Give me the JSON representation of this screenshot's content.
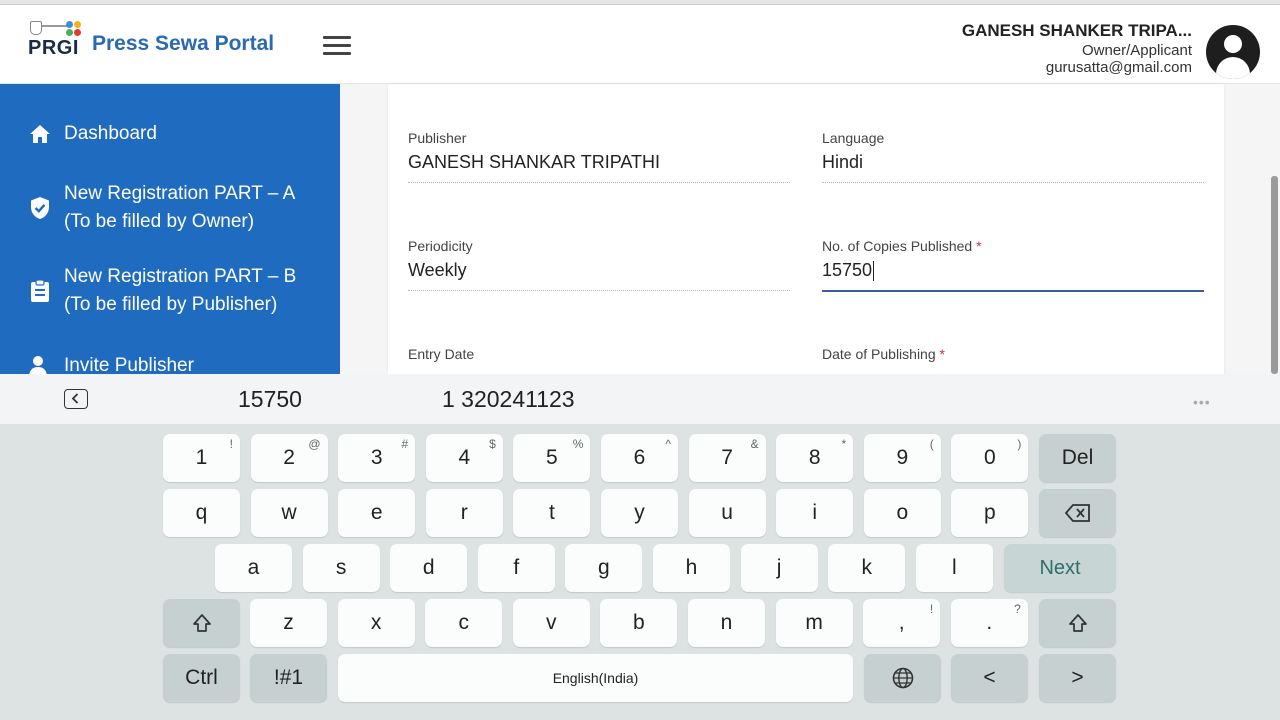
{
  "header": {
    "logo_text": "PRGI",
    "brand": "Press Sewa Portal",
    "user_name": "GANESH SHANKER TRIPA...",
    "user_role": "Owner/Applicant",
    "user_email": "gurusatta@gmail.com"
  },
  "sidebar": {
    "items": [
      {
        "label": "Dashboard",
        "icon": "home-icon"
      },
      {
        "label": "New Registration PART – A",
        "label2": "(To be filled by Owner)",
        "icon": "shield-check-icon"
      },
      {
        "label": "New Registration PART – B",
        "label2": "(To be filled by Publisher)",
        "icon": "clipboard-icon"
      },
      {
        "label": "Invite Publisher",
        "icon": "user-plus-icon"
      }
    ]
  },
  "form": {
    "publisher_label": "Publisher",
    "publisher_value": "GANESH SHANKAR TRIPATHI",
    "language_label": "Language",
    "language_value": "Hindi",
    "periodicity_label": "Periodicity",
    "periodicity_value": "Weekly",
    "copies_label": "No. of Copies Published",
    "copies_value": "15750",
    "entry_date_label": "Entry Date",
    "publishing_date_label": "Date of Publishing",
    "required_mark": "*"
  },
  "keyboard": {
    "suggestions": [
      "15750",
      "1 320241123"
    ],
    "row1": [
      {
        "k": "1",
        "s": "!"
      },
      {
        "k": "2",
        "s": "@"
      },
      {
        "k": "3",
        "s": "#"
      },
      {
        "k": "4",
        "s": "$"
      },
      {
        "k": "5",
        "s": "%"
      },
      {
        "k": "6",
        "s": "^"
      },
      {
        "k": "7",
        "s": "&"
      },
      {
        "k": "8",
        "s": "*"
      },
      {
        "k": "9",
        "s": "("
      },
      {
        "k": "0",
        "s": ")"
      }
    ],
    "del": "Del",
    "row2": [
      "q",
      "w",
      "e",
      "r",
      "t",
      "y",
      "u",
      "i",
      "o",
      "p"
    ],
    "row3": [
      "a",
      "s",
      "d",
      "f",
      "g",
      "h",
      "j",
      "k",
      "l"
    ],
    "next": "Next",
    "row4": [
      "z",
      "x",
      "c",
      "v",
      "b",
      "n",
      "m"
    ],
    "comma": {
      "k": ",",
      "s": "!"
    },
    "period": {
      "k": ".",
      "s": "?"
    },
    "ctrl": "Ctrl",
    "sym": "!#1",
    "space": "English(India)",
    "left": "<",
    "right": ">"
  },
  "colors": {
    "sidebar": "#1f6bbf",
    "brand": "#2a6ab3",
    "active_underline": "#3b5ba9",
    "required": "#d32f2f",
    "next_text": "#2e6f67"
  }
}
